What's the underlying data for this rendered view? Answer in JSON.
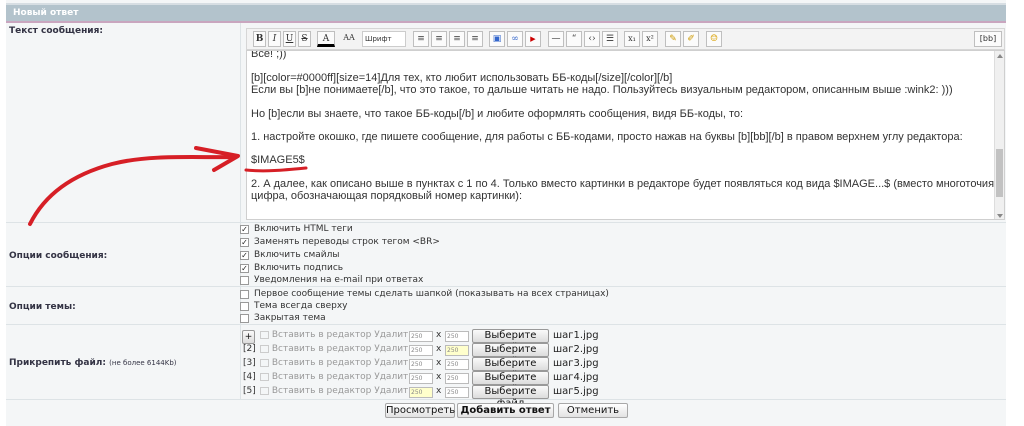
{
  "header": {
    "title": "Новый ответ"
  },
  "labels": {
    "message": "Текст сообщения:",
    "msg_options": "Опции сообщения:",
    "topic_options": "Опции темы:",
    "attach": "Прикрепить файл:",
    "attach_note": "(не более 6144Kb)"
  },
  "toolbar": {
    "bold": "B",
    "italic": "I",
    "underline": "U",
    "strike": "S",
    "size": "AA",
    "font": "Шрифт",
    "bb": "[bb]",
    "superscript": "x²",
    "subscript": "x₁"
  },
  "editor": {
    "lines": [
      "Все! ;))",
      "[b][color=#0000ff][size=14]Для тех, кто любит использовать ББ-коды[/size][/color][/b]",
      "Если вы [b]не понимаете[/b], что это такое, то дальше читать не надо. Пользуйтесь визуальным редактором, описанным выше  :wink2:  )))",
      "Но [b]если вы знаете, что такое ББ-коды[/b] и любите оформлять сообщения, видя ББ-коды, то:",
      "1. настройте окошко, где пишете сообщение, для работы с ББ-кодами, просто нажав на буквы [b][bb][/b] в правом верхнем углу редактора:",
      "$IMAGE5$",
      "2. А далее, как описано выше в пунктах с 1 по 4. Только вместо картинки в редакторе будет появляться код вида $IMAGE...$ (вместо многоточия",
      "цифра, обозначающая порядковый номер картинки):"
    ]
  },
  "msg_options": [
    {
      "text": "Включить HTML теги",
      "checked": true
    },
    {
      "text": "Заменять переводы строк тегом <BR>",
      "checked": true
    },
    {
      "text": "Включить смайлы",
      "checked": true
    },
    {
      "text": "Включить подпись",
      "checked": true
    },
    {
      "text": "Уведомления на e-mail при ответах",
      "checked": false
    }
  ],
  "topic_options": [
    {
      "text": "Первое сообщение темы сделать шапкой (показывать на всех страницах)"
    },
    {
      "text": "Тема всегда сверху"
    },
    {
      "text": "Закрытая тема"
    }
  ],
  "files": {
    "insert_text": "Вставить в редактор Удалить",
    "width": "250",
    "height": "250",
    "x": "x",
    "choose": "Выберите файл",
    "plus": "+",
    "rows": [
      {
        "num": "",
        "name": "шаг1.jpg"
      },
      {
        "num": "[2]",
        "name": "шаг2.jpg"
      },
      {
        "num": "[3]",
        "name": "шаг3.jpg"
      },
      {
        "num": "[4]",
        "name": "шаг4.jpg"
      },
      {
        "num": "[5]",
        "name": "шаг5.jpg"
      }
    ]
  },
  "buttons": {
    "preview": "Просмотреть",
    "submit": "Добавить ответ",
    "cancel": "Отменить"
  },
  "colors": {
    "header": "#b3c3cc",
    "arrow": "#d61f26",
    "highlight": "#ffffcc"
  }
}
